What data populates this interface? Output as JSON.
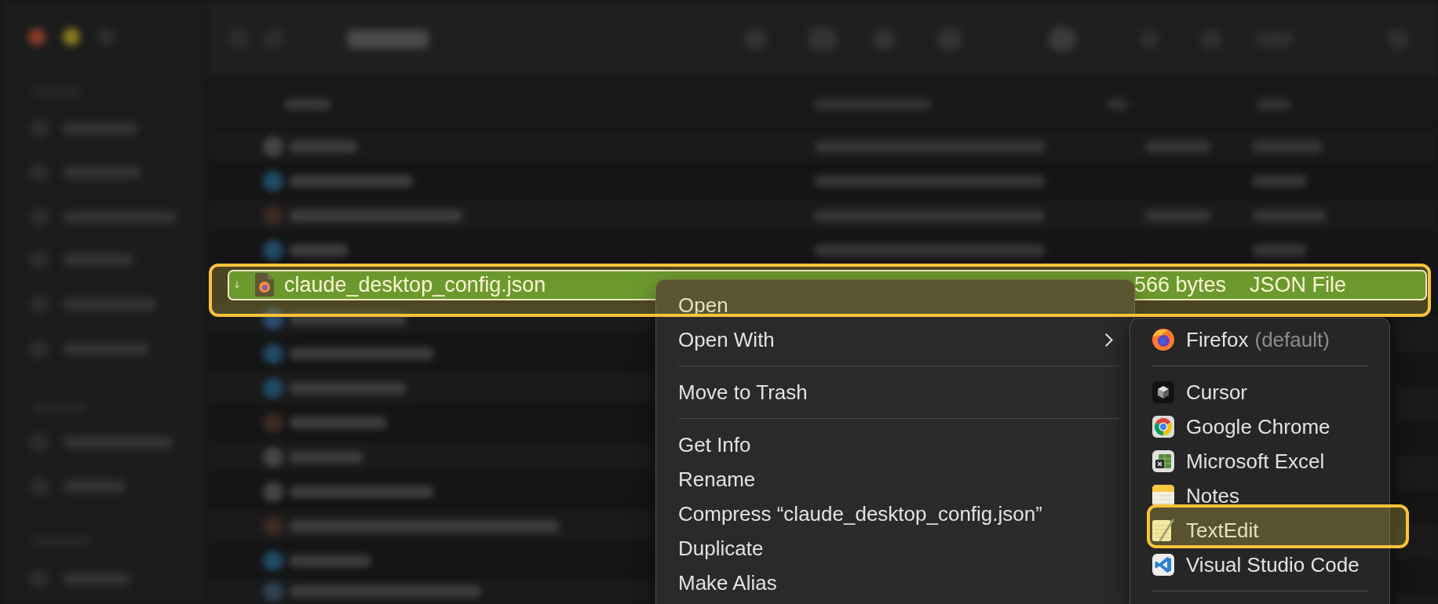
{
  "file_list": {
    "rows": [
      {
        "name": "claude_desktop_config.json",
        "size": "566 bytes",
        "file_type": "JSON File",
        "selected": true,
        "highlighted": true
      }
    ]
  },
  "context_menu": {
    "groups": [
      {
        "items": [
          {
            "label": "Open",
            "has_submenu": false
          },
          {
            "label": "Open With",
            "has_submenu": true
          }
        ]
      },
      {
        "items": [
          {
            "label": "Move to Trash",
            "has_submenu": false
          }
        ]
      },
      {
        "items": [
          {
            "label": "Get Info",
            "has_submenu": false
          },
          {
            "label": "Rename",
            "has_submenu": false
          },
          {
            "label": "Compress “claude_desktop_config.json”",
            "has_submenu": false
          },
          {
            "label": "Duplicate",
            "has_submenu": false
          },
          {
            "label": "Make Alias",
            "has_submenu": false
          }
        ]
      }
    ]
  },
  "open_with_menu": {
    "groups": [
      {
        "items": [
          {
            "label": "Firefox",
            "note": "(default)",
            "highlighted": false
          }
        ]
      },
      {
        "items": [
          {
            "label": "Cursor",
            "highlighted": false
          },
          {
            "label": "Google Chrome",
            "highlighted": false
          },
          {
            "label": "Microsoft Excel",
            "highlighted": false
          },
          {
            "label": "Notes",
            "highlighted": false
          },
          {
            "label": "TextEdit",
            "highlighted": true
          },
          {
            "label": "Visual Studio Code",
            "highlighted": false
          }
        ]
      }
    ],
    "trailing_separator": true
  }
}
